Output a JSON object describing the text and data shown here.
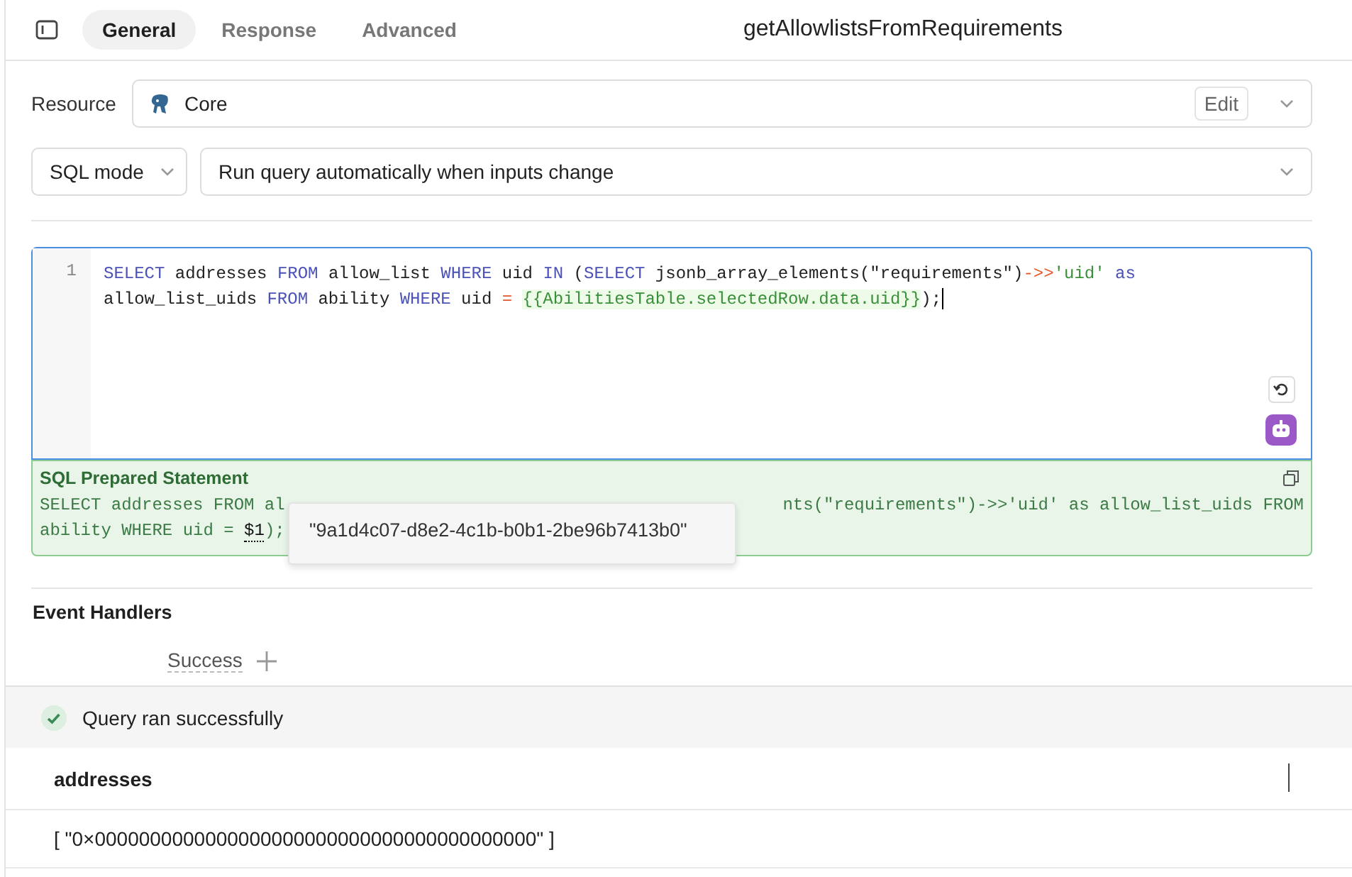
{
  "tabs": [
    {
      "label": "General",
      "selected": true
    },
    {
      "label": "Response",
      "selected": false
    },
    {
      "label": "Advanced",
      "selected": false
    }
  ],
  "query_name": "getAllowlistsFromRequirements",
  "resource": {
    "label": "Resource",
    "value": "Core",
    "edit_button": "Edit"
  },
  "mode": {
    "value": "SQL mode"
  },
  "trigger": {
    "value": "Run query automatically when inputs change"
  },
  "editor": {
    "line_number": "1",
    "wrapped_lines": [
      {
        "tokens": [
          {
            "kind": "keyword",
            "text": "SELECT"
          },
          {
            "kind": "plain",
            "text": " addresses "
          },
          {
            "kind": "keyword",
            "text": "FROM"
          },
          {
            "kind": "plain",
            "text": " allow_list "
          },
          {
            "kind": "keyword",
            "text": "WHERE"
          },
          {
            "kind": "plain",
            "text": " uid "
          },
          {
            "kind": "keyword",
            "text": "IN"
          },
          {
            "kind": "plain",
            "text": " ("
          },
          {
            "kind": "keyword",
            "text": "SELECT"
          },
          {
            "kind": "plain",
            "text": " jsonb_array_elements(\"requirements\")"
          },
          {
            "kind": "operator",
            "text": "->>"
          },
          {
            "kind": "string",
            "text": "'uid'"
          },
          {
            "kind": "keyword",
            "text": " as"
          }
        ]
      },
      {
        "tokens": [
          {
            "kind": "plain",
            "text": "allow_list_uids "
          },
          {
            "kind": "keyword",
            "text": "FROM"
          },
          {
            "kind": "plain",
            "text": " ability "
          },
          {
            "kind": "keyword",
            "text": "WHERE"
          },
          {
            "kind": "plain",
            "text": " uid "
          },
          {
            "kind": "operator",
            "text": "= "
          },
          {
            "kind": "template",
            "text": "{{AbilitiesTable.selectedRow.data.uid}}"
          },
          {
            "kind": "plain",
            "text": ");"
          }
        ]
      }
    ]
  },
  "prepared": {
    "title": "SQL Prepared Statement",
    "line1_start": "SELECT addresses FROM al",
    "line1_end": "nts(\"requirements\")->>'uid' as allow_list_uids FROM",
    "line2": "ability WHERE uid = ",
    "param": "$1",
    "line2_end": ");",
    "tooltip": "\"9a1d4c07-d8e2-4c1b-b0b1-2be96b7413b0\""
  },
  "event_handlers": {
    "title": "Event Handlers",
    "success_label": "Success"
  },
  "results": {
    "status": "Query ran successfully",
    "columns": [
      "addresses"
    ],
    "rows": [
      [
        "[ \"0×0000000000000000000000000000000000000000\" ]"
      ]
    ]
  }
}
